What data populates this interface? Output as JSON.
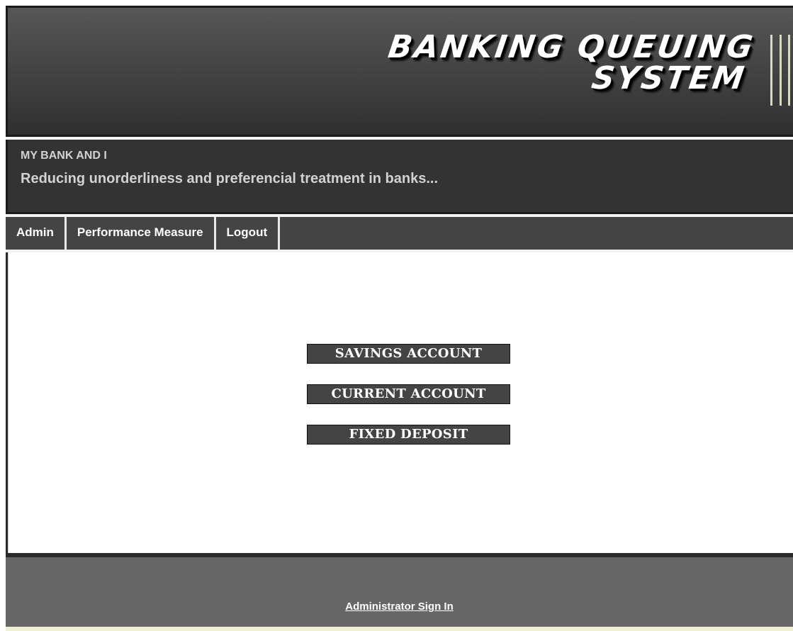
{
  "header": {
    "logo_line1": "BANKING QUEUING",
    "logo_line2": "SYSTEM",
    "site_title": "MY BANK AND I",
    "tagline": "Reducing unorderliness and preferencial treatment in banks..."
  },
  "nav": {
    "items": [
      {
        "label": "Admin"
      },
      {
        "label": "Performance Measure"
      },
      {
        "label": "Logout"
      }
    ]
  },
  "main": {
    "buttons": [
      {
        "label": "SAVINGS ACCOUNT"
      },
      {
        "label": "CURRENT ACCOUNT"
      },
      {
        "label": "FIXED DEPOSIT"
      }
    ]
  },
  "footer": {
    "link_label": "Administrator Sign In"
  },
  "colors": {
    "nav_bg": "#444444",
    "button_bg": "#444444",
    "footer_bg": "#666666"
  }
}
